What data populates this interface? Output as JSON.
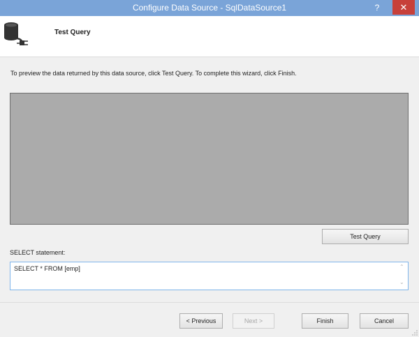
{
  "window": {
    "title": "Configure Data Source - SqlDataSource1",
    "help_label": "?",
    "close_label": "✕",
    "accent_color": "#7aa4d8"
  },
  "header": {
    "icon": "database-plug-icon",
    "step_title": "Test Query"
  },
  "main": {
    "instructions": "To preview the data returned by this data source, click Test Query. To complete this wizard, click Finish.",
    "test_query_label": "Test Query",
    "select_label": "SELECT statement:",
    "select_value": "SELECT * FROM [emp]"
  },
  "footer": {
    "previous_label": "< Previous",
    "next_label": "Next >",
    "finish_label": "Finish",
    "cancel_label": "Cancel"
  }
}
